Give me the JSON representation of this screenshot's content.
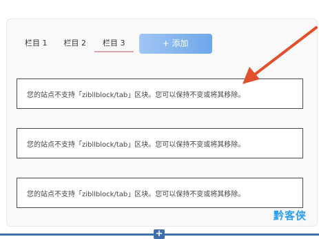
{
  "tabs": [
    {
      "label": "栏目 1"
    },
    {
      "label": "栏目 2"
    },
    {
      "label": "栏目 3"
    }
  ],
  "active_tab_index": 2,
  "add_button": {
    "label": "+ 添加"
  },
  "notices": [
    {
      "text": "您的站点不支持「zibllblock/tab」区块。您可以保持不变或将其移除。"
    },
    {
      "text": "您的站点不支持「zibllblock/tab」区块。您可以保持不变或将其移除。"
    },
    {
      "text": "您的站点不支持「zibllblock/tab」区块。您可以保持不变或将其移除。"
    }
  ],
  "insert_button": {
    "label": "+"
  },
  "watermark": {
    "text": "黔客侠"
  },
  "colors": {
    "accent_blue": "#6ea7ea",
    "active_tab_underline": "#d9a6ae",
    "annotation_arrow": "#e0502a",
    "inserter_bar": "#3f6fae",
    "watermark": "#2a9df4"
  },
  "icons": {
    "annotation": "arrow-pointing-icon",
    "inserter": "plus-icon"
  }
}
